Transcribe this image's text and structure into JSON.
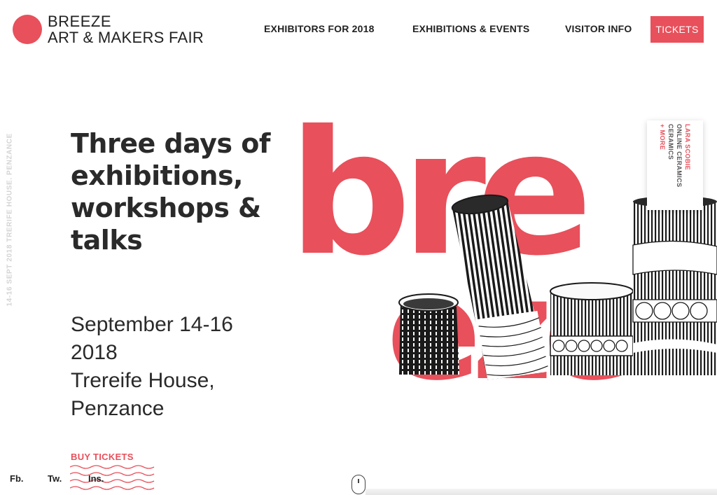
{
  "logo": {
    "line1": "BREEZE",
    "line2": "ART & MAKERS FAIR"
  },
  "nav": {
    "items": [
      {
        "label": "EXHIBITORS FOR 2018"
      },
      {
        "label": "EXHIBITIONS & EVENTS"
      },
      {
        "label": "VISITOR INFO"
      }
    ],
    "tickets_label": "TICKETS"
  },
  "side_caption": "14-16 SEPT 2018     TRERIFE HOUSE.     PENZANCE",
  "hero": {
    "headline": "Three days of exhibitions, workshops & talks",
    "dates_line1": "September 14-16",
    "dates_line2": "2018",
    "venue_line1": "Trereife House,",
    "venue_line2": "Penzance",
    "buy_label": "BUY TICKETS",
    "graphic_word_top": "bre",
    "graphic_word_bottom": "eze"
  },
  "feature_tag": {
    "name": "LARA SCOBIE",
    "line1": "ONLINE CERAMICS",
    "line2": "CERAMICS",
    "more": "+ MORE"
  },
  "social": {
    "facebook": "Fb.",
    "twitter": "Tw.",
    "instagram": "Ins."
  },
  "colors": {
    "accent": "#e8505b",
    "text": "#222222"
  }
}
